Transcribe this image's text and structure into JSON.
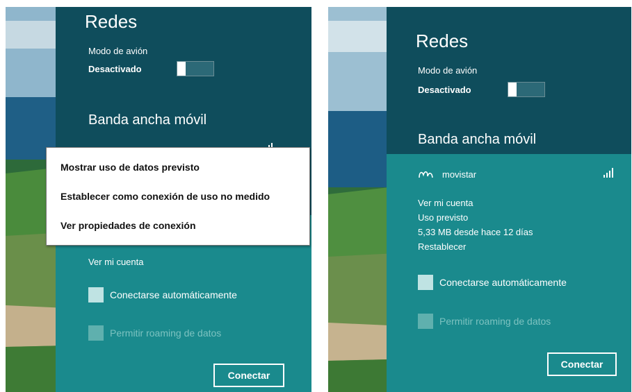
{
  "left": {
    "panel": {
      "title": "Redes",
      "airplane_label": "Modo de avión",
      "airplane_state": "Desactivado",
      "broadband_heading": "Banda ancha móvil"
    },
    "context_menu": {
      "items": [
        "Mostrar uso de datos previsto",
        "Establecer como conexión de uso no medido",
        "Ver propiedades de conexión"
      ]
    },
    "connection": {
      "account_link": "Ver mi cuenta",
      "auto_connect_label": "Conectarse automáticamente",
      "roaming_label": "Permitir roaming de datos",
      "connect_button": "Conectar"
    }
  },
  "right": {
    "panel": {
      "title": "Redes",
      "airplane_label": "Modo de avión",
      "airplane_state": "Desactivado",
      "broadband_heading": "Banda ancha móvil"
    },
    "connection": {
      "carrier_name": "movistar",
      "account_link": "Ver mi cuenta",
      "usage_label": "Uso previsto",
      "usage_value": "5,33 MB desde hace 12 días",
      "reset_link": "Restablecer",
      "auto_connect_label": "Conectarse automáticamente",
      "roaming_label": "Permitir roaming de datos",
      "connect_button": "Conectar"
    }
  },
  "colors": {
    "panel_dark": "#0f4d5c",
    "panel_teal": "#1a8a8d",
    "menu_bg": "#ffffff"
  },
  "icons": {
    "carrier_logo": "movistar-logo-icon",
    "signal": "signal-strength-icon"
  }
}
